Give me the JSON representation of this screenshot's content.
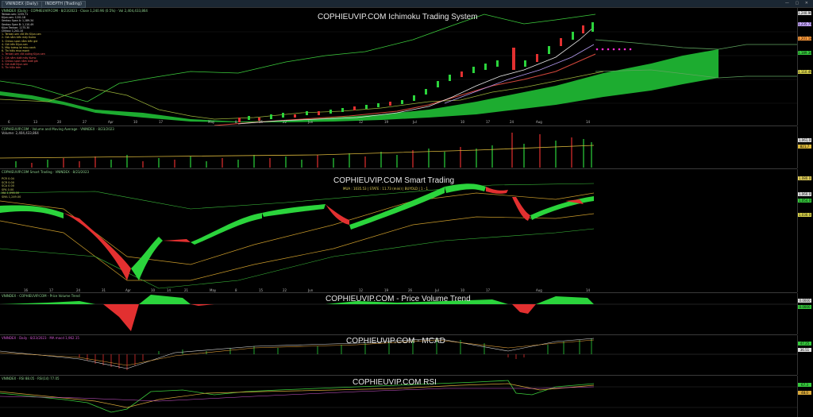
{
  "window": {
    "tabs": [
      "VNINDEX (Daily)",
      "INDEPTH (Trading)"
    ],
    "controls": "— ▢ ✕"
  },
  "pane1": {
    "title": "COPHIEUVIP.COM Ichimoku Trading System",
    "header": "VNINDEX (Daily) · COPHIEUVIP.COM · 8/23/2023 · Close 1,240.96 (0.5%) · Vol 2,404,433,864",
    "notes": [
      "Tenkan-sen: 1235.71",
      "Kijun-sen: 1201.18",
      "Senkou Span A: 1,189.34",
      "Senkou Span B: 1,110.49",
      "Kijun Tenkan: 1175.30",
      "Chikou: 1,241.10"
    ],
    "signals_buy": [
      "1- Tenkan-sen cắt lên Kijun-sen",
      "2- Giá nằm trên mây Kumo",
      "3- Chikou span nằm trên giá",
      "4- Giá trên Kijun-sen",
      "5- Mây tương lai màu xanh",
      "6- Tín hiệu mua mạnh"
    ],
    "signals_sell": [
      "1- Tenkan-sen cắt xuống Kijun-sen",
      "2- Giá nằm dưới mây Kumo",
      "3- Chikou span nằm dưới giá",
      "4- Giá dưới Kijun-sen",
      "5- Tín hiệu bán"
    ],
    "tags": [
      "1,240.96",
      "1,235.71",
      "1,201.18",
      "1,189.34",
      "1,110.49"
    ]
  },
  "pane2": {
    "header": "COPHIEUVIP.COM - Volume and Moving Average · VNINDEX · 8/23/2023",
    "sub": "Volume: 2,404,433,864",
    "tags": [
      "1,061,0",
      "821,7"
    ]
  },
  "pane3": {
    "title": "COPHIEUVIP.COM Smart Trading",
    "subtitle": "MUA : 1035.53 | STATE : 11.73 (mini) | BUYOLD | 1 - 1",
    "header": "COPHIEUVIP.COM Smart Trading · VNINDEX · 8/23/2023",
    "legend": [
      "PCR 0.04",
      "SCR 0.00",
      "SCA 0.00",
      "SPA 0.00",
      "MA 1,098.00",
      "SMA 1,249.00"
    ],
    "tags": [
      "1,080.0",
      "1,060.0",
      "1,054.0",
      "1,030.0"
    ]
  },
  "pane4": {
    "title": "COPHIEUVIP.COM - Price Volume Trend",
    "header": "VNINDEX - COPHIEUVIP.COM - Price Volume Trend",
    "tags": [
      "0.0000",
      "0.0000"
    ]
  },
  "pane5": {
    "title": "COPHIEUVIP.COM - MCAD",
    "header": "VNINDEX · Daily · 8/23/2023 · MA macd 1,962.15",
    "tags": [
      "47.25",
      "36.51"
    ]
  },
  "pane6": {
    "title": "COPHIEUVIP.COM RSI",
    "header": "VNINDEX · RSI 88.05 · RSI(14) 77.05",
    "tags": [
      "67.3",
      "48.0"
    ]
  },
  "xaxis": {
    "pane1": [
      "6",
      "13",
      "20",
      "27",
      "Apr",
      "10",
      "17",
      "May",
      "8",
      "15",
      "22",
      "Jun",
      "12",
      "19",
      "Jul",
      "10",
      "17",
      "24",
      "Aug",
      "14"
    ],
    "pane3": [
      "16",
      "17",
      "24",
      "31",
      "Apr",
      "10",
      "14",
      "21",
      "May",
      "8",
      "15",
      "22",
      "Jun",
      "12",
      "19",
      "26",
      "Jul",
      "10",
      "17",
      "Aug",
      "14"
    ]
  },
  "colors": {
    "cloud": "#22c33a",
    "up": "#2bd43c",
    "down": "#e23030",
    "kijun": "#d2473b",
    "tenkan": "#e6e6e6"
  }
}
